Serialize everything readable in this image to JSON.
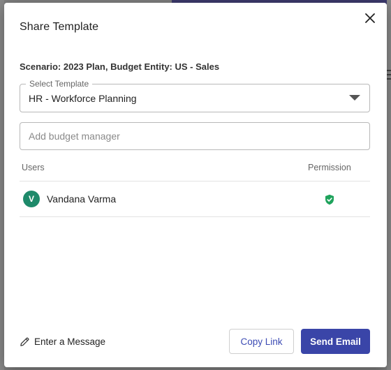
{
  "dialog": {
    "title": "Share Template",
    "context_label": "Scenario: 2023 Plan, Budget Entity: US - Sales"
  },
  "template_select": {
    "label": "Select Template",
    "value": "HR - Workforce Planning"
  },
  "manager_input": {
    "placeholder": "Add budget manager",
    "value": ""
  },
  "table": {
    "columns": [
      "Users",
      "Permission"
    ],
    "rows": [
      {
        "initial": "V",
        "name": "Vandana Varma",
        "permission_icon": "shield-check-icon"
      }
    ]
  },
  "footer": {
    "enter_message_label": "Enter a Message",
    "copy_link_label": "Copy Link",
    "send_email_label": "Send Email"
  },
  "colors": {
    "primary": "#3a45a8",
    "avatar": "#1e8a6a",
    "permission_ok": "#1fa35c"
  }
}
